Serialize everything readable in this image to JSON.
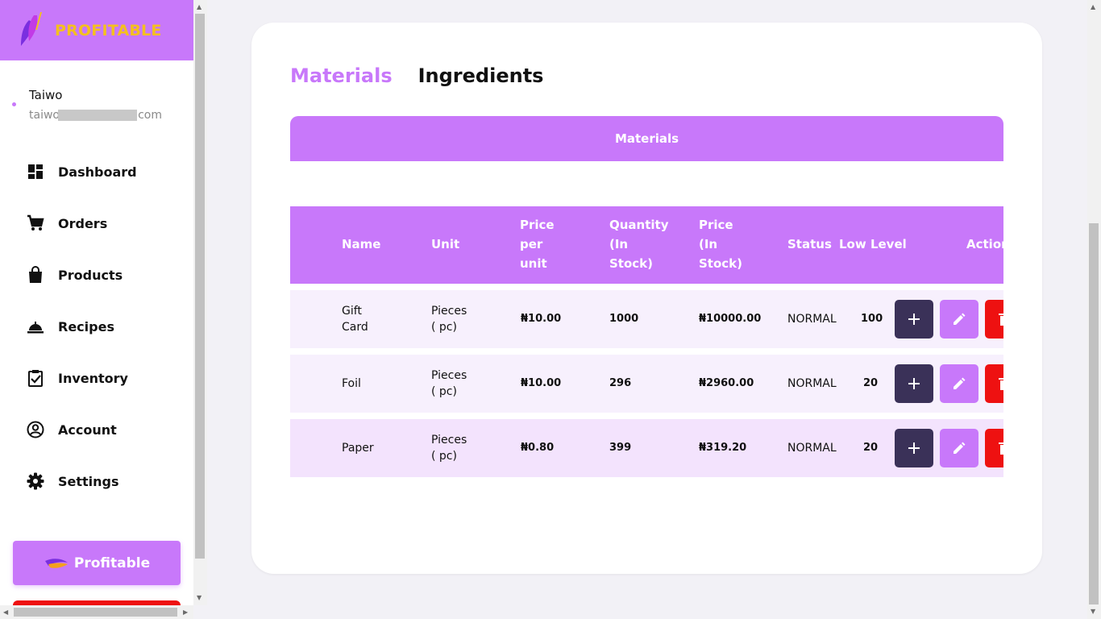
{
  "brand": {
    "name": "PROFITABLE"
  },
  "user": {
    "name": "Taiwo",
    "email": "taiwo.........@gmail.com"
  },
  "nav": [
    {
      "label": "Dashboard",
      "icon": "dashboard-icon"
    },
    {
      "label": "Orders",
      "icon": "cart-icon"
    },
    {
      "label": "Products",
      "icon": "bag-icon"
    },
    {
      "label": "Recipes",
      "icon": "bell-cloche-icon"
    },
    {
      "label": "Inventory",
      "icon": "clipboard-check-icon"
    },
    {
      "label": "Account",
      "icon": "account-circle-icon"
    },
    {
      "label": "Settings",
      "icon": "gear-icon"
    }
  ],
  "promo_button": {
    "label": "Profitable"
  },
  "tabs": [
    {
      "label": "Materials",
      "active": true
    },
    {
      "label": "Ingredients",
      "active": false
    }
  ],
  "section": {
    "title": "Materials"
  },
  "table": {
    "headers": {
      "name": "Name",
      "unit": "Unit",
      "price_per_unit": [
        "Price",
        "per",
        "unit"
      ],
      "quantity": [
        "Quantity",
        "(In",
        "Stock)"
      ],
      "price_in_stock": [
        "Price",
        "(In",
        "Stock)"
      ],
      "status": "Status",
      "low_level": "Low Level",
      "action": "Action"
    },
    "rows": [
      {
        "name": [
          "Gift",
          "Card"
        ],
        "unit": [
          "Pieces",
          "( pc)"
        ],
        "price_per_unit": "₦10.00",
        "quantity": "1000",
        "price_in_stock": "₦10000.00",
        "status": "NORMAL",
        "low_level": "100"
      },
      {
        "name": [
          "Foil"
        ],
        "unit": [
          "Pieces",
          "( pc)"
        ],
        "price_per_unit": "₦10.00",
        "quantity": "296",
        "price_in_stock": "₦2960.00",
        "status": "NORMAL",
        "low_level": "20"
      },
      {
        "name": [
          "Paper"
        ],
        "unit": [
          "Pieces",
          "( pc)"
        ],
        "price_per_unit": "₦0.80",
        "quantity": "399",
        "price_in_stock": "₦319.20",
        "status": "NORMAL",
        "low_level": "20"
      }
    ]
  },
  "colors": {
    "accent": "#c878fa",
    "brand_text": "#f4c01e",
    "add_button": "#3a3158",
    "delete_button": "#ee1111",
    "row_bg": [
      "#f7f0fd",
      "#f7f0fd",
      "#f3e3fd"
    ]
  }
}
